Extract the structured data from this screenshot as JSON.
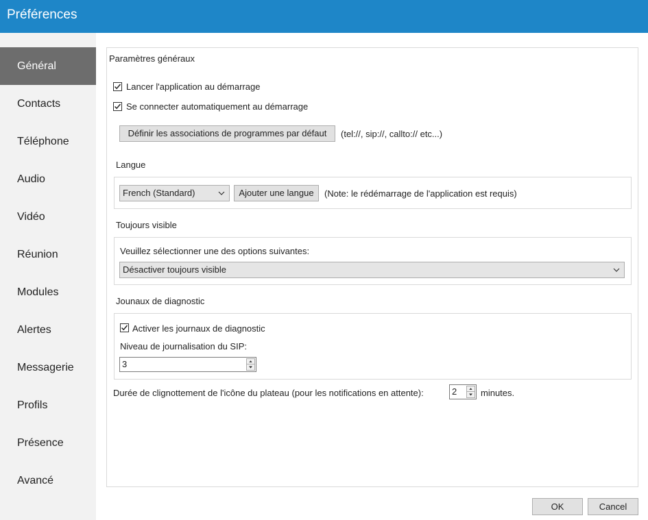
{
  "window": {
    "title": "Préférences"
  },
  "sidebar": {
    "items": [
      {
        "label": "Général",
        "active": true
      },
      {
        "label": "Contacts"
      },
      {
        "label": "Téléphone"
      },
      {
        "label": "Audio"
      },
      {
        "label": "Vidéo"
      },
      {
        "label": "Réunion"
      },
      {
        "label": "Modules"
      },
      {
        "label": "Alertes"
      },
      {
        "label": "Messagerie"
      },
      {
        "label": "Profils"
      },
      {
        "label": "Présence"
      },
      {
        "label": "Avancé"
      }
    ]
  },
  "general": {
    "section_title": "Paramètres généraux",
    "launch_at_startup": {
      "label": "Lancer l'application au démarrage",
      "checked": true
    },
    "auto_connect": {
      "label": "Se connecter automatiquement au démarrage",
      "checked": true
    },
    "default_assoc_button": "Définir les associations de programmes par défaut",
    "default_assoc_note": "(tel://, sip://, callto:// etc...)"
  },
  "language": {
    "section_title": "Langue",
    "selected": "French (Standard)",
    "add_button": "Ajouter une langue",
    "note": "(Note: le rédémarrage de l'application est requis)"
  },
  "always_visible": {
    "section_title": "Toujours visible",
    "prompt": "Veuillez sélectionner une des options suivantes:",
    "selected": "Désactiver toujours visible"
  },
  "diagnostics": {
    "section_title": "Jounaux de diagnostic",
    "enable": {
      "label": "Activer les journaux de diagnostic",
      "checked": true
    },
    "sip_level_label": "Niveau de journalisation du SIP:",
    "sip_level_value": "3"
  },
  "tray_blink": {
    "label": "Durée de clignottement de l'icône du plateau (pour les notifications en attente):",
    "value": "2",
    "unit": "minutes."
  },
  "footer": {
    "ok": "OK",
    "cancel": "Cancel"
  }
}
